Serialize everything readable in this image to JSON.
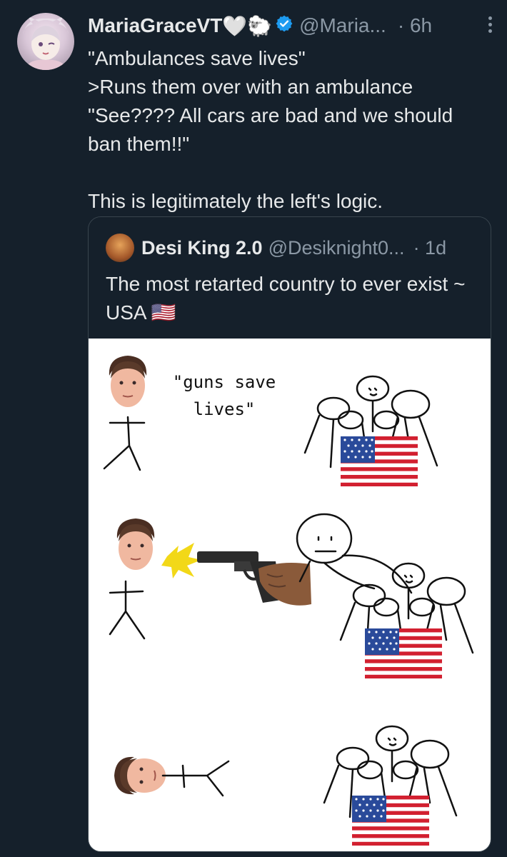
{
  "tweet": {
    "display_name": "MariaGraceVT",
    "name_emojis": "🤍🐑",
    "handle": "@Maria...",
    "time": "· 6h",
    "text": "\"Ambulances save lives\"\n>Runs them over with an ambulance\n\"See???? All cars are bad and we should\nban them!!\"\n\nThis is legitimately the left's logic."
  },
  "quote": {
    "display_name": "Desi King 2.0",
    "handle": "@Desiknight0...",
    "time": "· 1d",
    "text": "The most retarted country to ever exist ~ USA 🇺🇸"
  },
  "meme": {
    "caption": "\"guns save lives\""
  },
  "colors": {
    "background": "#15202b",
    "text_primary": "#e7e9ea",
    "text_secondary": "#8b98a5",
    "verified_blue": "#1d9bf0",
    "border": "#38444d"
  },
  "icons": [
    "verified-badge-icon",
    "more-options-icon"
  ]
}
